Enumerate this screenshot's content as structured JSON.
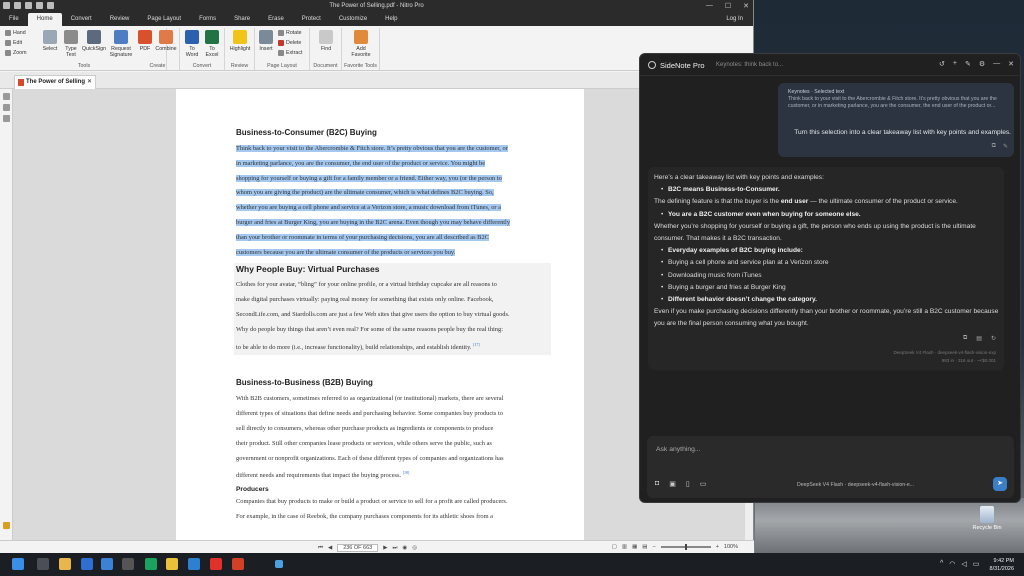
{
  "nitro": {
    "title": "The Power of Selling.pdf - Nitro Pro",
    "menu": [
      "File",
      "Home",
      "Convert",
      "Review",
      "Page Layout",
      "Forms",
      "Share",
      "Erase",
      "Protect",
      "Customize",
      "Help"
    ],
    "login": "Log In",
    "ribbon": {
      "hand": "Hand",
      "edit": "Edit",
      "zoom": "Zoom",
      "select": "Select",
      "type_text": "Type Text",
      "quicksign": "QuickSign",
      "request_signature": "Request Signature",
      "pdf": "PDF",
      "combine": "Combine",
      "to_word": "To Word",
      "to_excel": "To Excel",
      "highlight": "Highlight",
      "insert": "Insert",
      "rotate": "Rotate",
      "delete": "Delete",
      "extract": "Extract",
      "find": "Find",
      "add_favorite": "Add Favorite",
      "groups": {
        "tools": "Tools",
        "create": "Create",
        "convert": "Convert",
        "review": "Review",
        "page_layout": "Page Layout",
        "document": "Document",
        "favorite_tools": "Favorite Tools"
      }
    },
    "tab_title": "The Power of Selling",
    "doc": {
      "h1": "Business-to-Consumer (B2C) Buying",
      "p1_lines": [
        "Think back to your visit to the Abercrombie & Fitch store. It’s pretty obvious that you are the customer, or",
        "in marketing parlance, you are the consumer, the end user of the product or service. You might be",
        "shopping for yourself or buying a gift for a family member or a friend. Either way, you (or the person to",
        "whom you are giving the product) are the ultimate consumer, which is what defines B2C buying. So,",
        "whether you are buying a cell phone and service at a Verizon store, a music download from iTunes, or a",
        "burger and fries at Burger King, you are buying in the B2C arena. Even though you may behave differently",
        "than your brother or roommate in terms of your purchasing decisions, you are all described as B2C",
        "customers because you are the ultimate consumer of the products or services you buy."
      ],
      "h2": "Why People Buy: Virtual Purchases",
      "p2_lines": [
        "Clothes for your avatar, “bling” for your online profile, or a virtual birthday cupcake are all reasons to",
        "make digital purchases virtually: paying real money for something that exists only online. Facebook,",
        "SecondLife.com, and Stardolls.com are just a few Web sites that give users the option to buy virtual goods.",
        "Why do people buy things that aren’t even real? For some of the same reasons people buy the real thing:",
        "to be able to do more (i.e., increase functionality), build relationships, and establish identity."
      ],
      "fn1": "[17]",
      "h3": "Business-to-Business (B2B) Buying",
      "p3_lines": [
        "With B2B customers, sometimes referred to as organizational (or institutional) markets, there are several",
        "different types of situations that define needs and purchasing behavior. Some companies buy products to",
        "sell directly to consumers, whereas other purchase products as ingredients or components to produce",
        "their product. Still other companies lease products or services, while others serve the public, such as",
        "government or nonprofit organizations. Each of these different types of companies and organizations has",
        "different needs and requirements that impact the buying process."
      ],
      "fn2": "[18]",
      "h4": "Producers",
      "p4_lines": [
        "Companies that buy products to make or build a product or service to sell for a profit are called producers.",
        "For example, in the case of Reebok, the company purchases components for its athletic shoes from a"
      ]
    },
    "status": {
      "page": "236 OF 663",
      "zoom": "100%"
    }
  },
  "sidenote": {
    "app_name": "SideNote Pro",
    "subtitle": "Keynotes: think back to...",
    "quote_label": "Keynotes · Selected text",
    "quote_text": "Think back to your visit to the Abercrombie & Fitch store. It’s pretty obvious that you are the customer, or in marketing parlance, you are the consumer, the end user of the product or...",
    "user_query": "Turn this selection into a clear takeaway list with key points and examples.",
    "answer": {
      "intro": "Here’s a clear takeaway list with key points and examples:",
      "b1": "B2C means Business-to-Consumer.",
      "t1_pre": "The defining feature is that the buyer is the ",
      "t1_bold": "end user",
      "t1_post": " — the ultimate consumer of the product or service.",
      "b2": "You are a B2C customer even when buying for someone else.",
      "t2": "Whether you’re shopping for yourself or buying a gift, the person who ends up using the product is the ultimate consumer. That makes it a B2C transaction.",
      "b3": "Everyday examples of B2C buying include:",
      "ex": [
        "Buying a cell phone and service plan at a Verizon store",
        "Downloading music from iTunes",
        "Buying a burger and fries at Burger King"
      ],
      "b4": "Different behavior doesn’t change the category.",
      "t4": "Even if you make purchasing decisions differently than your brother or roommate, you’re still a B2C customer because you are the final person consuming what you bought.",
      "model": "DeepSeek V4 Flash · deepseek-v4-flash-vision-exp",
      "meta": "983 in · 316 out · ~<$0.001"
    },
    "input_placeholder": "Ask anything...",
    "input_model": "DeepSeek V4 Flash · deepseek-v4-flash-vision-e..."
  },
  "desktop": {
    "recycle_bin": "Recycle Bin"
  },
  "taskbar": {
    "time": "9:42 PM",
    "date": "8/31/2026"
  }
}
